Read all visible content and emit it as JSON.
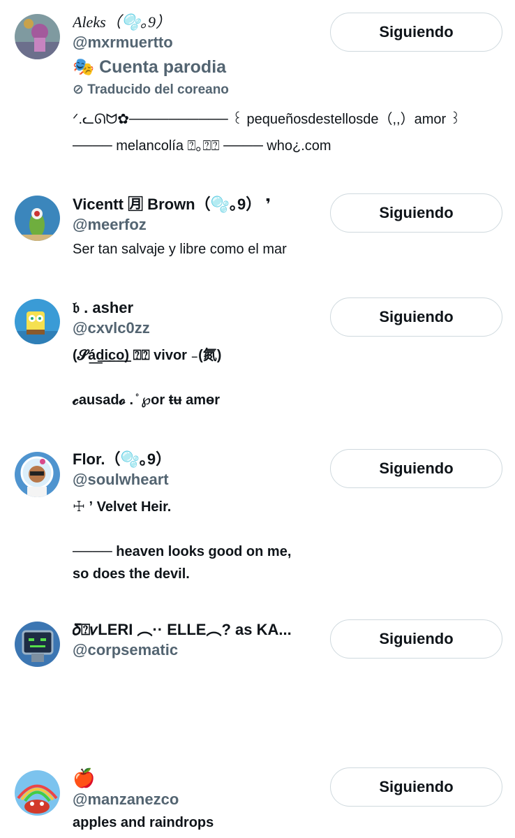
{
  "users": [
    {
      "name": "Aleks（🫧｡9）",
      "handle": "@mxrmuertto",
      "badge": "🎭 Cuenta parodia",
      "translated": "⊘ Traducido del coreano",
      "bio": [
        "ᐟ.ᓚᘏᗢ✿────────── ꒰ pequeñosdestellosde（,,）amor ꒱",
        "──── melancolía ⍰｡⍰⍰ ──── who¿.com"
      ],
      "button": "Siguiendo",
      "avatar_color": "#8fa3a8"
    },
    {
      "name": "Vicentt 🈷 Brown（🫧｡9） ❜",
      "handle": "@meerfoz",
      "bio": [
        "Ser tan salvaje y libre como el mar"
      ],
      "button": "Siguiendo",
      "avatar_color": "#3a7fb0"
    },
    {
      "name": "𝔟 . asher",
      "handle": "@cxvlc0zz",
      "bio": [
        "(𝓢á͟d͟i͟c͟o͟) ⍰⍰ vivor ₋(氮)",
        "",
        "𝓬ausad𝓸 . ̊ ℘or ŧʉ amɵr"
      ],
      "button": "Siguiendo",
      "avatar_color": "#2f8fc8"
    },
    {
      "name": "Flor.（🫧｡9）",
      "handle": "@soulwheart",
      "bio": [
        "☩ ʼ Velvet Heir.",
        "",
        "──── heaven looks good on me,",
        "so does the devil."
      ],
      "button": "Siguiendo",
      "avatar_color": "#5a9bd4"
    },
    {
      "name": "𝛿⍰𝜈LERI ︵·· ELLE︵? as KA...",
      "handle": "@corpsematic",
      "bio": [],
      "button": "Siguiendo",
      "avatar_color": "#2c6fae"
    },
    {
      "name": "🍎",
      "handle": "@manzanezco",
      "bio": [
        "apples and raindrops"
      ],
      "button": "Siguiendo",
      "avatar_color": "#6bb7e6"
    }
  ]
}
